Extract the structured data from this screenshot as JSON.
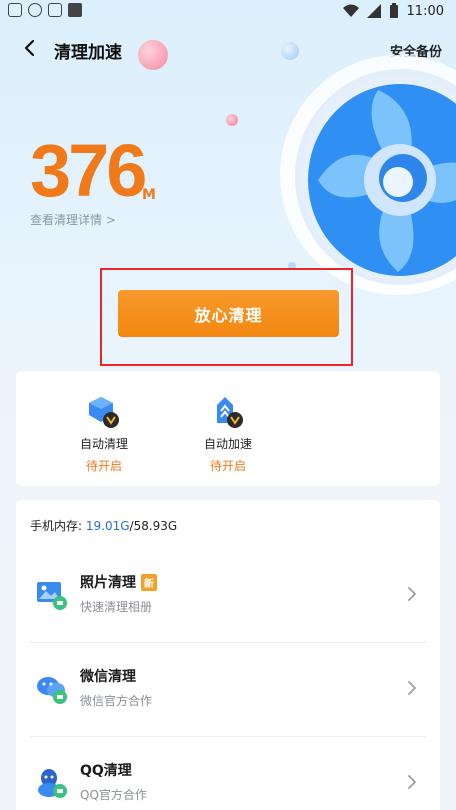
{
  "status_bar": {
    "time": "11:00"
  },
  "header": {
    "title": "清理加速",
    "action": "安全备份"
  },
  "hero": {
    "size_value": "376",
    "size_unit": "M",
    "detail_link": "查看清理详情 >"
  },
  "primary_button": "放心清理",
  "features": [
    {
      "label": "自动清理",
      "status": "待开启",
      "icon": "auto-clean-icon"
    },
    {
      "label": "自动加速",
      "status": "待开启",
      "icon": "auto-boost-icon"
    }
  ],
  "memory": {
    "label": "手机内存:",
    "used": "19.01G",
    "total": "/58.93G"
  },
  "list": [
    {
      "title": "照片清理",
      "badge": "新",
      "subtitle": "快速清理相册",
      "icon": "photo-clean-icon"
    },
    {
      "title": "微信清理",
      "subtitle": "微信官方合作",
      "icon": "wechat-clean-icon"
    },
    {
      "title": "QQ清理",
      "subtitle": "QQ官方合作",
      "icon": "qq-clean-icon"
    }
  ],
  "colors": {
    "accent": "#f07a1a",
    "button": "#f3870f",
    "highlight_border": "#e8262b",
    "memory_used": "#2a6bd8"
  }
}
